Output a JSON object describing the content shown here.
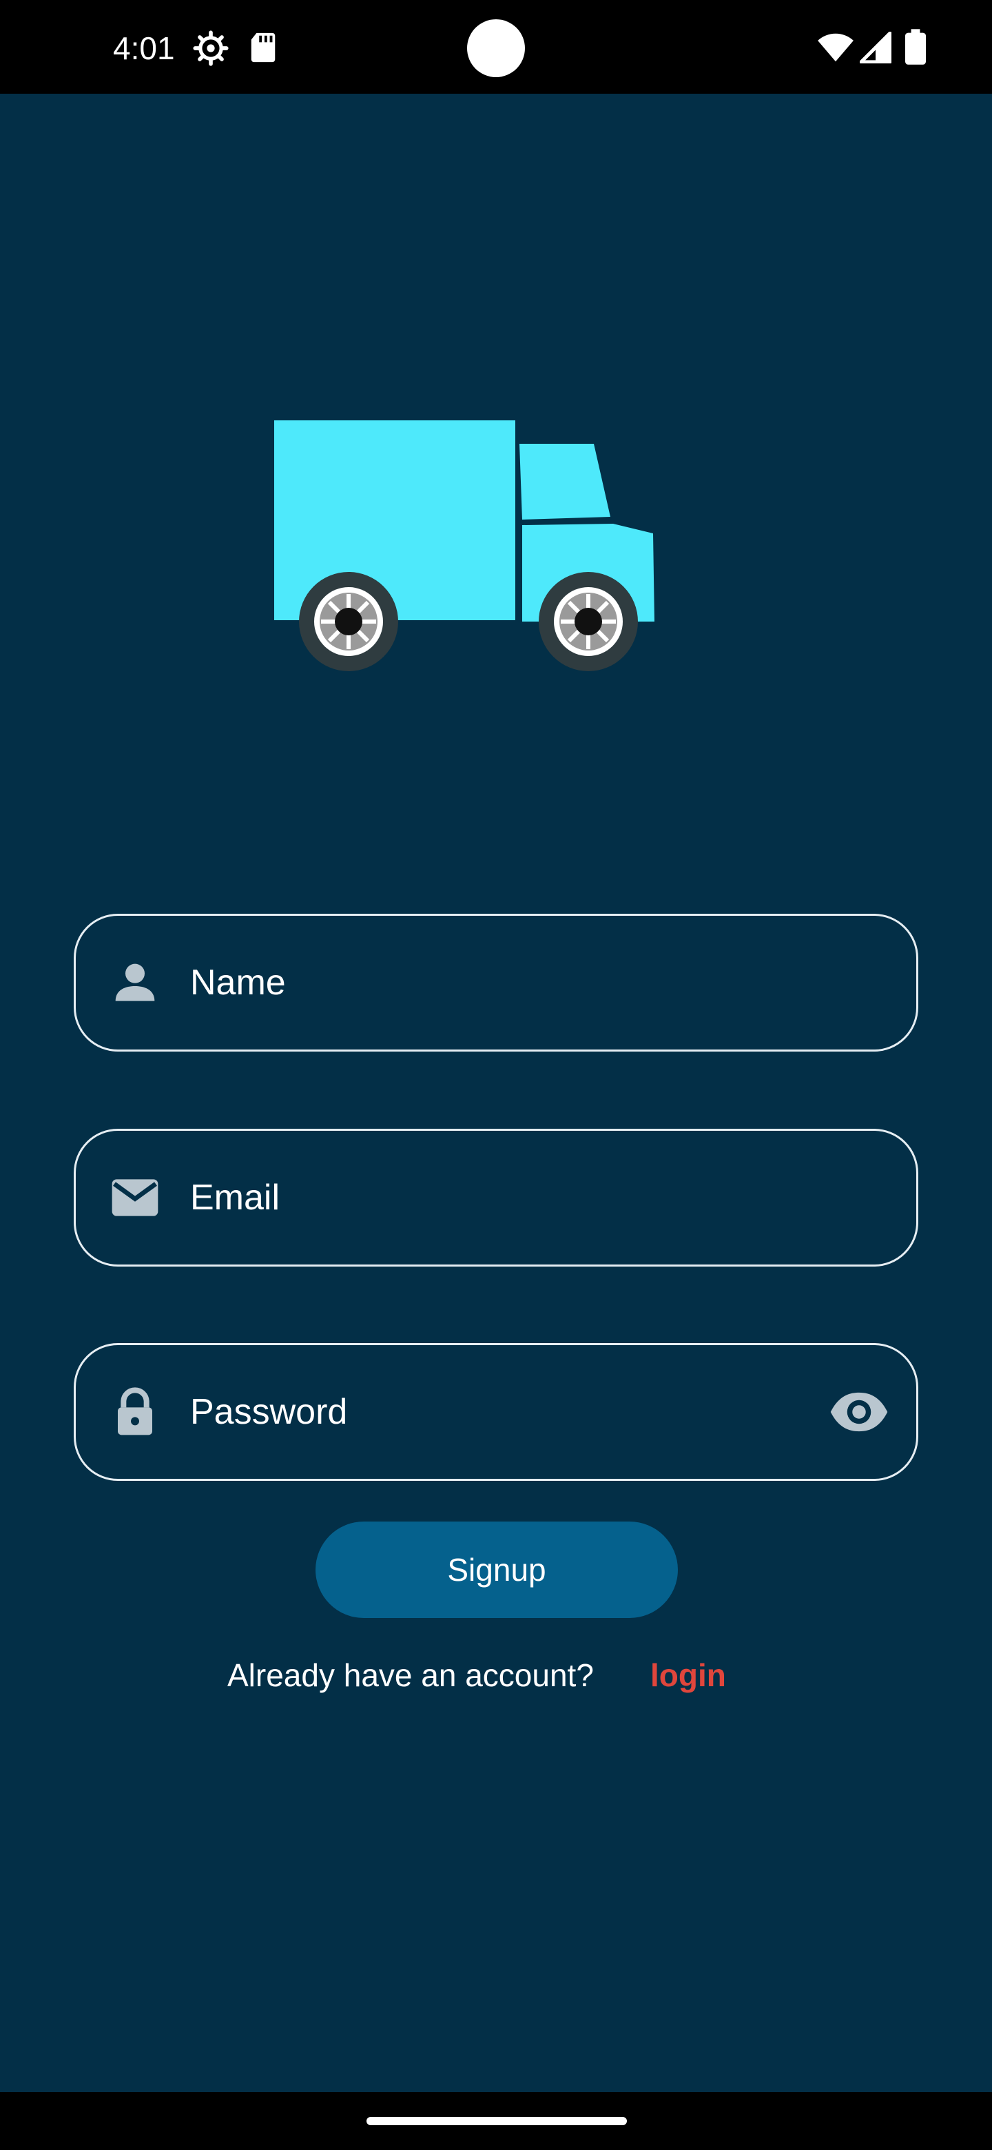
{
  "status_bar": {
    "time": "4:01",
    "icons": [
      "gear-icon",
      "sd-card-icon",
      "wifi-icon",
      "signal-icon",
      "battery-icon"
    ]
  },
  "illustration": {
    "name": "delivery-truck",
    "color": "#4ee9fb"
  },
  "form": {
    "name_field": {
      "placeholder": "Name",
      "icon": "person-icon"
    },
    "email_field": {
      "placeholder": "Email",
      "icon": "mail-icon"
    },
    "password_field": {
      "placeholder": "Password",
      "icon": "lock-icon",
      "toggle_icon": "eye-icon"
    },
    "signup_label": "Signup",
    "footer_prompt": "Already have an account?",
    "login_label": "login"
  },
  "colors": {
    "background": "#032f47",
    "button": "#05618d",
    "link": "#e0463c",
    "field_border": "#e6eef3",
    "icon_gray": "#b9c6cf"
  }
}
